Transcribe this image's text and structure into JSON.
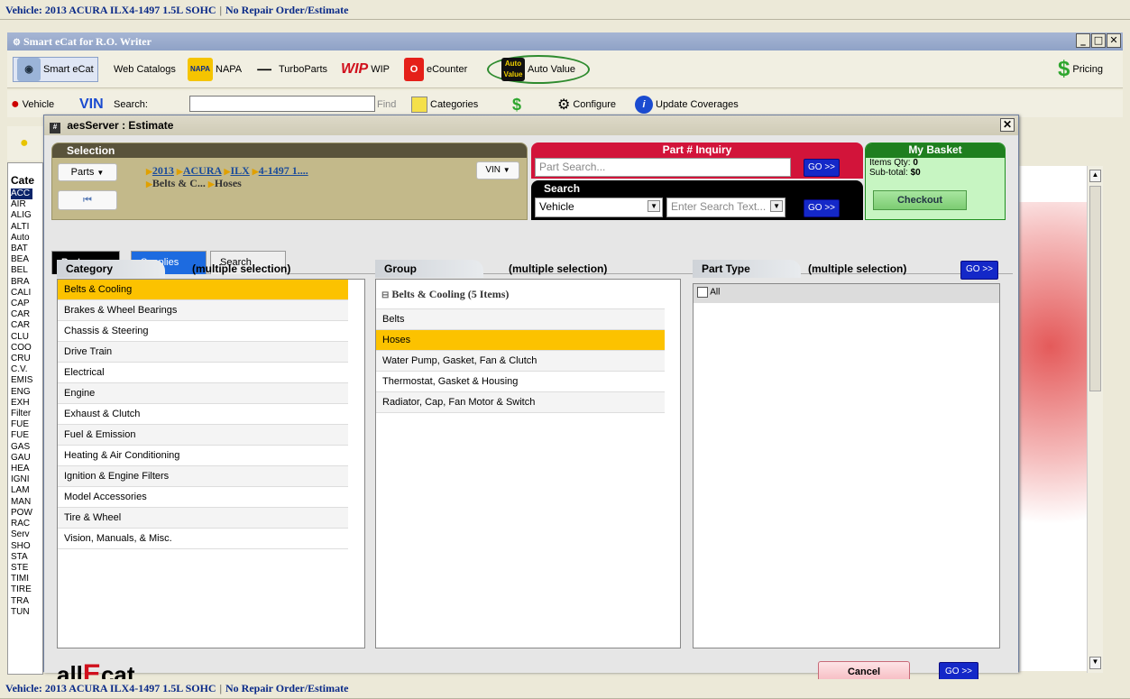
{
  "status_top": {
    "vehicle": "Vehicle: 2013 ACURA ILX4-1497 1.5L SOHC",
    "order": "No Repair Order/Estimate"
  },
  "status_bottom": {
    "vehicle": "Vehicle: 2013 ACURA ILX4-1497 1.5L SOHC",
    "order": "No Repair Order/Estimate"
  },
  "window": {
    "title": "Smart eCat for R.O. Writer"
  },
  "toolbar": {
    "smart_ecat": "Smart eCat",
    "web_catalogs": "Web Catalogs",
    "napa": "NAPA",
    "turboparts": "TurboParts",
    "wip": "WIP",
    "ecounter": "eCounter",
    "auto_value": "Auto Value",
    "pricing": "Pricing",
    "napa_logo": "NAPA",
    "wip_logo": "WIP",
    "auto_value_logo": "Auto Value"
  },
  "toolbar2": {
    "vehicle": "Vehicle",
    "vin": "VIN",
    "search": "Search:",
    "find": "Find",
    "categories": "Categories",
    "configure": "Configure",
    "update": "Update Coverages"
  },
  "left_panel": {
    "header": "Cate",
    "items": [
      "ACC",
      "AIR",
      "ALIG",
      "ALTI",
      "Auto",
      "BAT",
      "BEA",
      "BEL",
      "BRA",
      "CALI",
      "CAP",
      "CAR",
      "CAR",
      "CLU",
      "COO",
      "CRU",
      "C.V.",
      "EMIS",
      "ENG",
      "EXH",
      "Filter",
      "FUE",
      "FUE",
      "GAS",
      "GAU",
      "HEA",
      "IGNI",
      "LAM",
      "MAN",
      "POW",
      "RAC",
      "Serv",
      "SHO",
      "STA",
      "STE",
      "TIMI",
      "TIRE",
      "TRA",
      "TUN"
    ]
  },
  "dialog": {
    "title": "aesServer : Estimate",
    "selection": {
      "header": "Selection",
      "parts_dropdown": "Parts",
      "vin_dropdown": "VIN",
      "crumb": {
        "year": "2013",
        "make": "ACURA",
        "model": "ILX",
        "engine": "4-1497 1...."
      },
      "crumb2": {
        "cat": "Belts & C...",
        "group": "Hoses"
      }
    },
    "part_inquiry": {
      "header": "Part # Inquiry",
      "placeholder": "Part Search...",
      "go": "GO >>"
    },
    "search": {
      "header": "Search",
      "type": "Vehicle",
      "placeholder": "Enter Search Text...",
      "go": "GO >>"
    },
    "basket": {
      "header": "My Basket",
      "qty_label": "Items Qty:",
      "qty": "0",
      "subtotal_label": "Sub-total:",
      "subtotal": "$0",
      "checkout": "Checkout"
    },
    "tabs": [
      "Parts",
      "Supplies",
      "Search"
    ],
    "category": {
      "label": "Category",
      "sub": "(multiple selection)",
      "items": [
        "Belts & Cooling",
        "Brakes & Wheel Bearings",
        "Chassis & Steering",
        "Drive Train",
        "Electrical",
        "Engine",
        "Exhaust & Clutch",
        "Fuel & Emission",
        "Heating & Air Conditioning",
        "Ignition & Engine Filters",
        "Model Accessories",
        "Tire & Wheel",
        "Vision, Manuals, & Misc."
      ]
    },
    "group": {
      "label": "Group",
      "sub": "(multiple selection)",
      "section": "Belts & Cooling (5 Items)",
      "items": [
        "Belts",
        "Hoses",
        "Water Pump, Gasket, Fan & Clutch",
        "Thermostat, Gasket & Housing",
        "Radiator, Cap, Fan Motor & Switch"
      ]
    },
    "part_type": {
      "label": "Part Type",
      "sub": "(multiple selection)",
      "go": "GO >>",
      "all": "All"
    },
    "footer": {
      "logo_a": "all",
      "logo_e": "E",
      "logo_b": "cat",
      "cancel": "Cancel",
      "go": "GO >>"
    }
  }
}
